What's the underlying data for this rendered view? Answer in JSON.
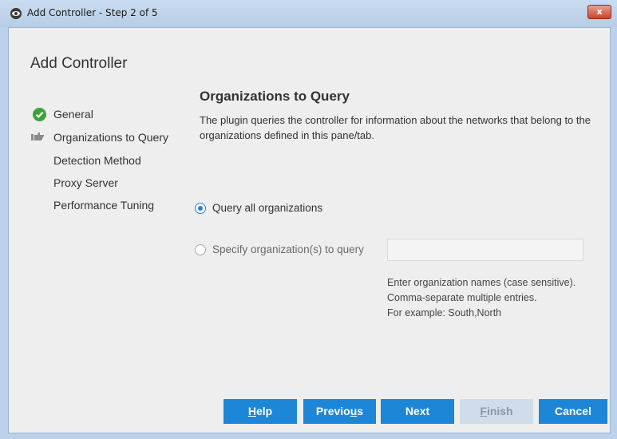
{
  "window": {
    "title": "Add Controller - Step 2 of 5",
    "close_label": "x"
  },
  "dialog": {
    "heading": "Add Controller"
  },
  "steps": [
    {
      "label": "General",
      "status": "completed",
      "icon": "check-circle-icon"
    },
    {
      "label": "Organizations to Query",
      "status": "current",
      "icon": "pointing-hand-icon"
    },
    {
      "label": "Detection Method",
      "status": "pending"
    },
    {
      "label": "Proxy Server",
      "status": "pending"
    },
    {
      "label": "Performance Tuning",
      "status": "pending"
    }
  ],
  "pane": {
    "title": "Organizations to Query",
    "description": "The plugin queries the controller for information about the networks that belong to the organizations defined in this pane/tab.",
    "option_all": {
      "label": "Query all organizations",
      "selected": true
    },
    "option_specify": {
      "label": "Specify organization(s) to query",
      "selected": false
    },
    "org_input": {
      "value": "",
      "placeholder": ""
    },
    "hint": [
      "Enter organization names (case sensitive).",
      "Comma-separate multiple entries.",
      "For example: South,North"
    ]
  },
  "buttons": {
    "help": {
      "mnemonic": "H",
      "rest": "elp"
    },
    "previous": {
      "before": "Previo",
      "mnemonic": "u",
      "after": "s"
    },
    "next": {
      "label": "Next"
    },
    "finish": {
      "mnemonic": "F",
      "rest": "inish",
      "enabled": false
    },
    "cancel": {
      "label": "Cancel"
    }
  },
  "colors": {
    "accent": "#1d86d6",
    "disabled_button": "#d0dcea",
    "check": "#3aa33a"
  }
}
